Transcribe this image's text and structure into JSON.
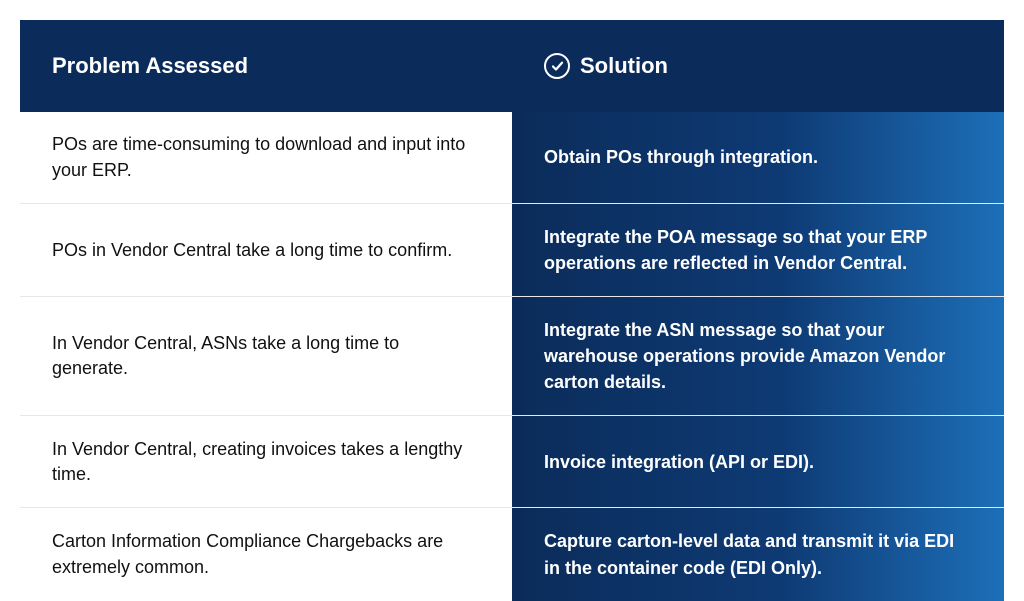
{
  "header": {
    "problem_label": "Problem Assessed",
    "solution_label": "Solution"
  },
  "rows": [
    {
      "problem": "POs are time-consuming to download and input into your ERP.",
      "solution": "Obtain POs through integration."
    },
    {
      "problem": "POs in Vendor Central take a long time to confirm.",
      "solution": "Integrate the POA message so that your ERP operations are reflected in Vendor Central."
    },
    {
      "problem": "In Vendor Central, ASNs take a long time to generate.",
      "solution": "Integrate the ASN message so that your warehouse operations provide Amazon Vendor carton details."
    },
    {
      "problem": "In Vendor Central, creating invoices takes a lengthy time.",
      "solution": "Invoice integration (API or EDI)."
    },
    {
      "problem": "Carton Information Compliance Chargebacks are extremely common.",
      "solution": "Capture carton-level data and transmit it via EDI in the container code (EDI Only)."
    }
  ]
}
